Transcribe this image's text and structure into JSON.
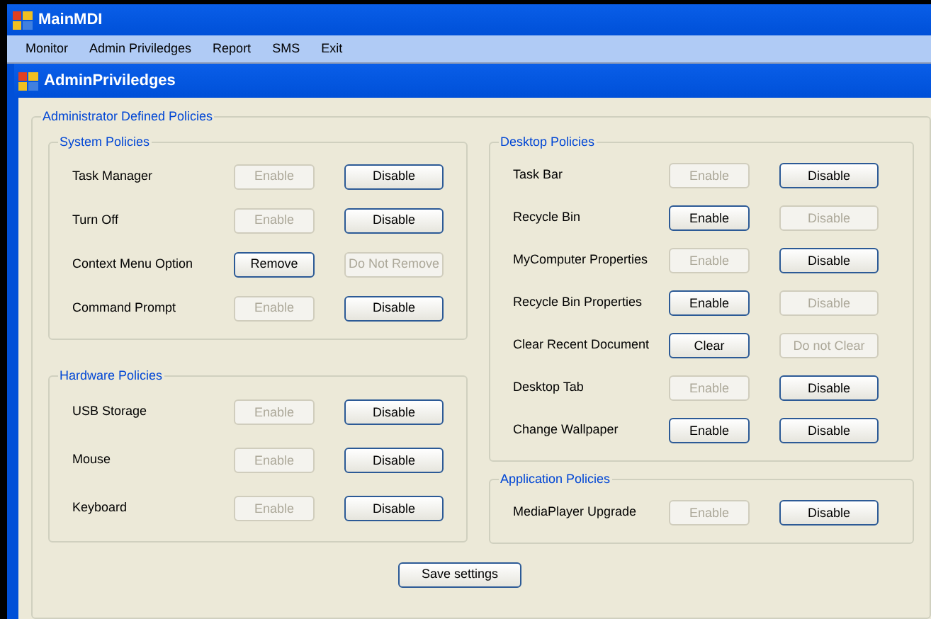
{
  "window": {
    "title": "MainMDI"
  },
  "menu": [
    "Monitor",
    "Admin Priviledges",
    "Report",
    "SMS",
    "Exit"
  ],
  "child": {
    "title": "AdminPriviledges"
  },
  "outer_group": {
    "title": "Administrator Defined Policies"
  },
  "left_column": [
    {
      "title": "System Policies",
      "rows": [
        {
          "label": "Task Manager",
          "buttons": [
            {
              "label": "Enable",
              "disabled": true
            },
            {
              "label": "Disable",
              "disabled": false
            }
          ]
        },
        {
          "label": "Turn Off",
          "buttons": [
            {
              "label": "Enable",
              "disabled": true
            },
            {
              "label": "Disable",
              "disabled": false
            }
          ]
        },
        {
          "label": "Context Menu Option",
          "buttons": [
            {
              "label": "Remove",
              "disabled": false
            },
            {
              "label": "Do Not Remove",
              "disabled": true
            }
          ]
        },
        {
          "label": "Command Prompt",
          "buttons": [
            {
              "label": "Enable",
              "disabled": true
            },
            {
              "label": "Disable",
              "disabled": false
            }
          ]
        }
      ]
    },
    {
      "title": "Hardware Policies",
      "rows": [
        {
          "label": "USB Storage",
          "buttons": [
            {
              "label": "Enable",
              "disabled": true
            },
            {
              "label": "Disable",
              "disabled": false
            }
          ]
        },
        {
          "label": "Mouse",
          "buttons": [
            {
              "label": "Enable",
              "disabled": true
            },
            {
              "label": "Disable",
              "disabled": false
            }
          ]
        },
        {
          "label": "Keyboard",
          "buttons": [
            {
              "label": "Enable",
              "disabled": true
            },
            {
              "label": "Disable",
              "disabled": false
            }
          ]
        }
      ]
    }
  ],
  "right_column": [
    {
      "title": "Desktop Policies",
      "rows": [
        {
          "label": "Task Bar",
          "buttons": [
            {
              "label": "Enable",
              "disabled": true
            },
            {
              "label": "Disable",
              "disabled": false
            }
          ]
        },
        {
          "label": "Recycle Bin",
          "buttons": [
            {
              "label": "Enable",
              "disabled": false
            },
            {
              "label": "Disable",
              "disabled": true
            }
          ]
        },
        {
          "label": "MyComputer Properties",
          "buttons": [
            {
              "label": "Enable",
              "disabled": true
            },
            {
              "label": "Disable",
              "disabled": false
            }
          ]
        },
        {
          "label": "Recycle Bin Properties",
          "buttons": [
            {
              "label": "Enable",
              "disabled": false
            },
            {
              "label": "Disable",
              "disabled": true
            }
          ]
        },
        {
          "label": "Clear Recent Document",
          "buttons": [
            {
              "label": "Clear",
              "disabled": false
            },
            {
              "label": "Do not Clear",
              "disabled": true
            }
          ]
        },
        {
          "label": "Desktop Tab",
          "buttons": [
            {
              "label": "Enable",
              "disabled": true
            },
            {
              "label": "Disable",
              "disabled": false
            }
          ]
        },
        {
          "label": "Change Wallpaper",
          "buttons": [
            {
              "label": "Enable",
              "disabled": false
            },
            {
              "label": "Disable",
              "disabled": false
            }
          ]
        }
      ]
    },
    {
      "title": "Application Policies",
      "rows": [
        {
          "label": "MediaPlayer Upgrade",
          "buttons": [
            {
              "label": "Enable",
              "disabled": true
            },
            {
              "label": "Disable",
              "disabled": false
            }
          ]
        }
      ]
    }
  ],
  "save_button": "Save settings"
}
